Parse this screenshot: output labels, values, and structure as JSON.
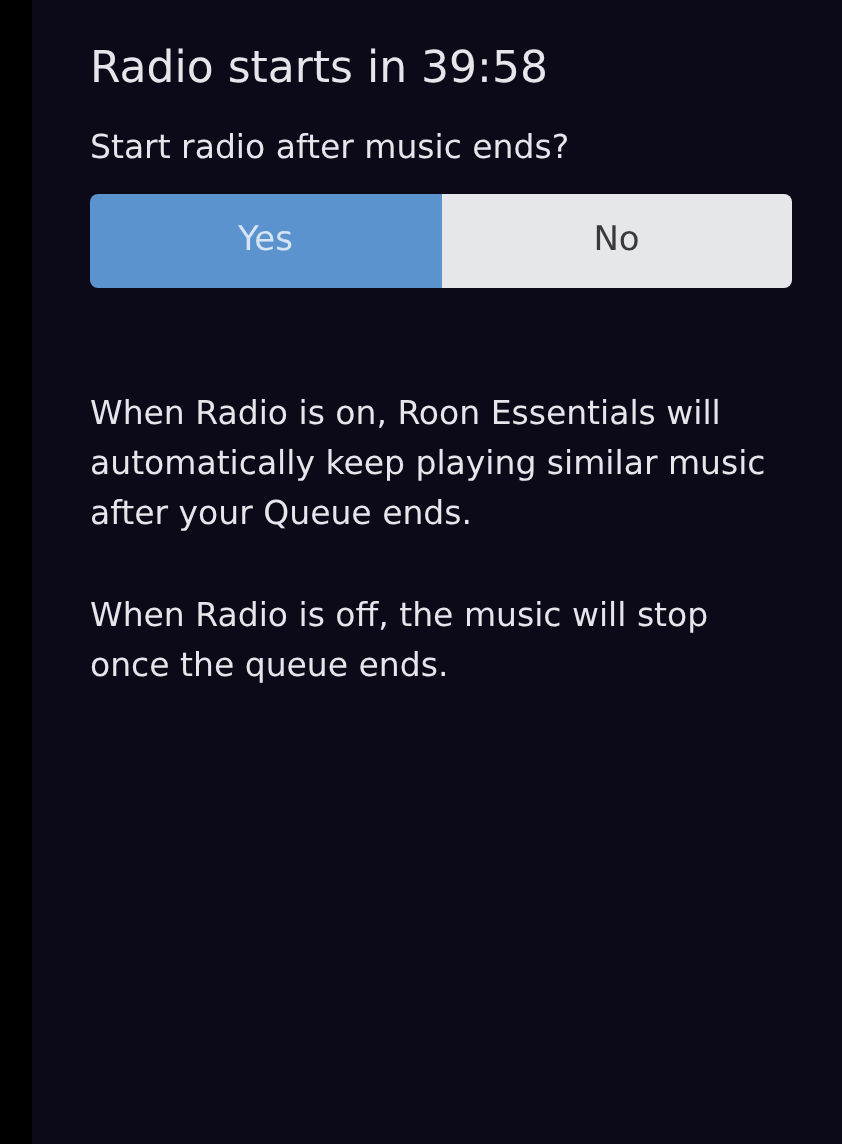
{
  "title": "Radio starts in 39:58",
  "question": "Start radio after music ends?",
  "options": [
    {
      "label": "Yes",
      "selected": true
    },
    {
      "label": "No",
      "selected": false
    }
  ],
  "paragraphs": [
    "When Radio is on, Roon Essentials will automatically keep playing similar music after your Queue ends.",
    "When Radio is off, the music will stop once the queue ends."
  ]
}
